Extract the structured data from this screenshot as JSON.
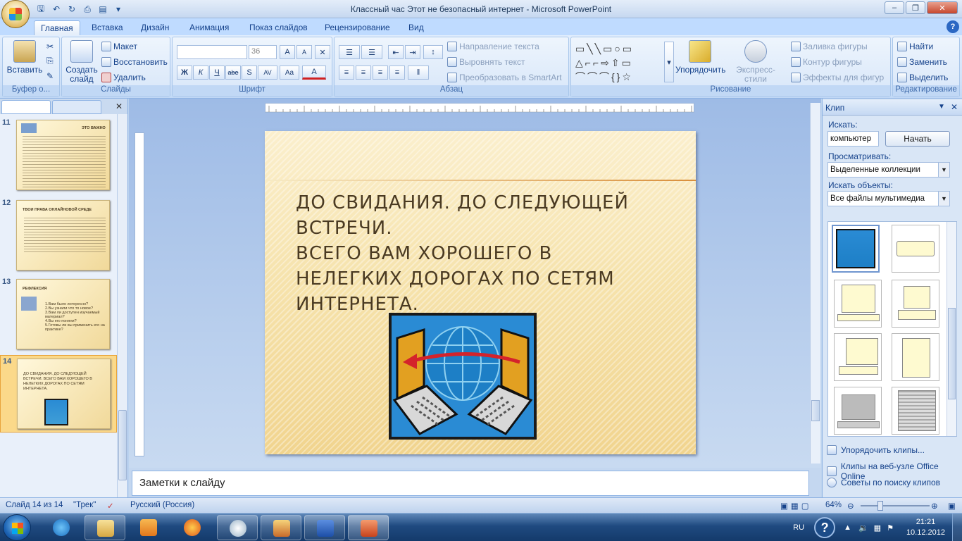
{
  "window": {
    "title": "Классный час Этот не безопасный интернет - Microsoft PowerPoint"
  },
  "qat": {
    "icons": [
      "save-icon",
      "undo-icon",
      "redo-icon",
      "print-icon",
      "preview-icon"
    ]
  },
  "tabs": [
    {
      "label": "Главная"
    },
    {
      "label": "Вставка"
    },
    {
      "label": "Дизайн"
    },
    {
      "label": "Анимация"
    },
    {
      "label": "Показ слайдов"
    },
    {
      "label": "Рецензирование"
    },
    {
      "label": "Вид"
    }
  ],
  "ribbon": {
    "clipboard": {
      "paste": "Вставить",
      "title": "Буфер о..."
    },
    "slides": {
      "new_slide": "Создать слайд",
      "layout": "Макет",
      "reset": "Восстановить",
      "delete": "Удалить",
      "title": "Слайды"
    },
    "font": {
      "size": "36",
      "title": "Шрифт",
      "bold": "Ж",
      "italic": "К",
      "underline": "Ч",
      "strike": "abe",
      "shadow": "S",
      "spacing": "AV",
      "case": "Aa",
      "color": "A",
      "grow": "A",
      "shrink": "A"
    },
    "paragraph": {
      "text_direction": "Направление текста",
      "align_text": "Выровнять текст",
      "smartart": "Преобразовать в SmartArt",
      "title": "Абзац"
    },
    "drawing": {
      "arrange": "Упорядочить",
      "quick_styles": "Экспресс-стили",
      "fill": "Заливка фигуры",
      "outline": "Контур фигуры",
      "effects": "Эффекты для фигур",
      "title": "Рисование"
    },
    "editing": {
      "find": "Найти",
      "replace": "Заменить",
      "select": "Выделить",
      "title": "Редактирование"
    }
  },
  "slides_panel": {
    "thumbnails": [
      {
        "number": "11",
        "title": "ЭТО ВАЖНО"
      },
      {
        "number": "12",
        "title": "ТВОИ ПРАВА ОНЛАЙНОВОЙ СРЕДЕ"
      },
      {
        "number": "13",
        "title": "РЕФЛЕКСИЯ",
        "items": [
          "1.Вам было интересно?",
          "2.Вы узнали что то новое?",
          "3.Вам ли доступен изучаемый материал?",
          "4.Вы его поняли?",
          "5.Готовы ли вы применить его на практике?"
        ]
      },
      {
        "number": "14",
        "title": "ДО СВИДАНИЯ. ДО СЛЕДУЮЩЕЙ ВСТРЕЧИ. ВСЕГО ВАМ ХОРОШЕГО В НЕЛЕГКИХ ДОРОГАХ ПО СЕТЯМ ИНТЕРНЕТА."
      }
    ]
  },
  "slide": {
    "text_line1": "До свидания. До следующей встречи.",
    "text_line2": "Всего вам хорошего в нелегких дорогах по сетям интернета."
  },
  "notes": {
    "placeholder": "Заметки к слайду"
  },
  "clip_pane": {
    "title": "Клип",
    "search_label": "Искать:",
    "search_value": "компьютер",
    "go_button": "Начать",
    "browse_label": "Просматривать:",
    "browse_value": "Выделенные коллекции",
    "type_label": "Искать объекты:",
    "type_value": "Все файлы мультимедиа",
    "links": [
      "Упорядочить клипы...",
      "Клипы на веб-узле Office Online",
      "Советы по поиску клипов"
    ]
  },
  "status": {
    "slide": "Слайд 14 из 14",
    "theme": "\"Трек\"",
    "language": "Русский (Россия)",
    "zoom": "64%"
  },
  "taskbar": {
    "lang": "RU",
    "time": "21:21",
    "date": "10.12.2012"
  }
}
